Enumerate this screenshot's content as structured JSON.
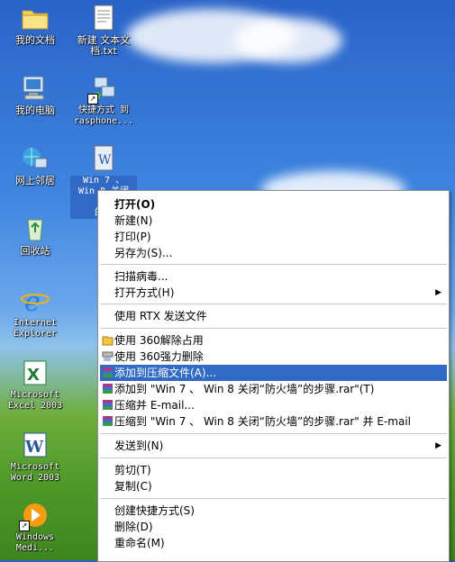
{
  "desktop": {
    "icons": [
      {
        "label": "我的文档"
      },
      {
        "label": "新建 文本文\n档.txt"
      },
      {
        "label": "我的电脑"
      },
      {
        "label": "快捷方式 到\nrasphone..."
      },
      {
        "label": "网上邻居"
      },
      {
        "label": "Win 7 、\nWin 8 关闭\n“防\n的步"
      },
      {
        "label": "回收站"
      },
      {
        "label": "Internet\nExplorer"
      },
      {
        "label": "Microsoft\nExcel 2003"
      },
      {
        "label": "Microsoft\nWord 2003"
      },
      {
        "label": "Windows\nMedi..."
      }
    ]
  },
  "context_menu": {
    "items": [
      {
        "label": "打开(O)"
      },
      {
        "label": "新建(N)"
      },
      {
        "label": "打印(P)"
      },
      {
        "label": "另存为(S)..."
      },
      {
        "label": "扫描病毒..."
      },
      {
        "label": "打开方式(H)"
      },
      {
        "label": "使用 RTX 发送文件"
      },
      {
        "label": "使用 360解除占用"
      },
      {
        "label": "使用 360强力删除"
      },
      {
        "label": "添加到压缩文件(A)..."
      },
      {
        "label": "添加到 \"Win 7 、 Win 8 关闭“防火墙”的步骤.rar\"(T)"
      },
      {
        "label": "压缩并 E-mail..."
      },
      {
        "label": "压缩到 \"Win 7 、 Win 8 关闭“防火墙”的步骤.rar\" 并 E-mail"
      },
      {
        "label": "发送到(N)"
      },
      {
        "label": "剪切(T)"
      },
      {
        "label": "复制(C)"
      },
      {
        "label": "创建快捷方式(S)"
      },
      {
        "label": "删除(D)"
      },
      {
        "label": "重命名(M)"
      }
    ],
    "highlight_color": "#316ac5"
  }
}
